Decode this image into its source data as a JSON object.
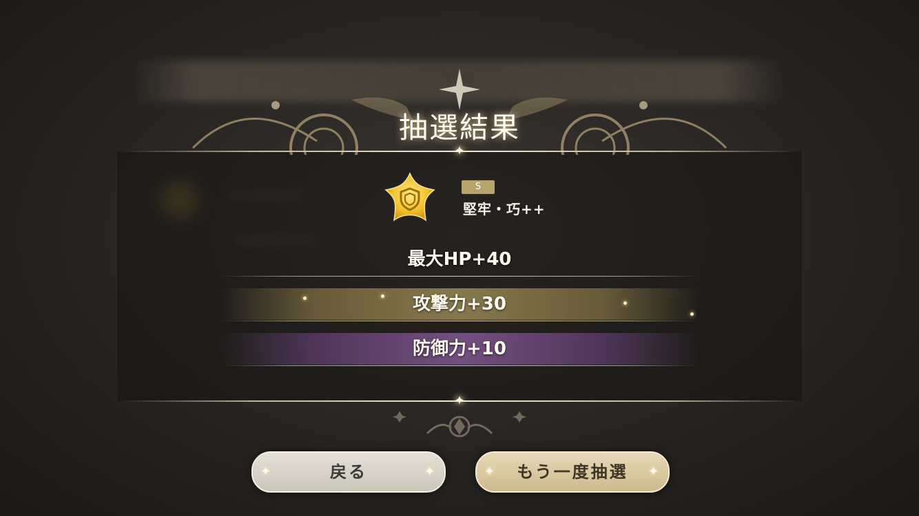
{
  "dialog": {
    "title": "抽選結果",
    "item": {
      "rank": "S",
      "name": "堅牢・巧++",
      "icon": "gold-star-shield-icon"
    },
    "stats": [
      {
        "label": "最大HP+40",
        "tier": "normal"
      },
      {
        "label": "攻撃力+30",
        "tier": "gold"
      },
      {
        "label": "防御力+10",
        "tier": "purple"
      }
    ]
  },
  "buttons": {
    "back_label": "戻る",
    "again_label": "もう一度抽選"
  },
  "colors": {
    "gold_highlight": "#c8b46e",
    "purple_highlight": "#9664aa",
    "rank_badge": "#b8a46e"
  }
}
